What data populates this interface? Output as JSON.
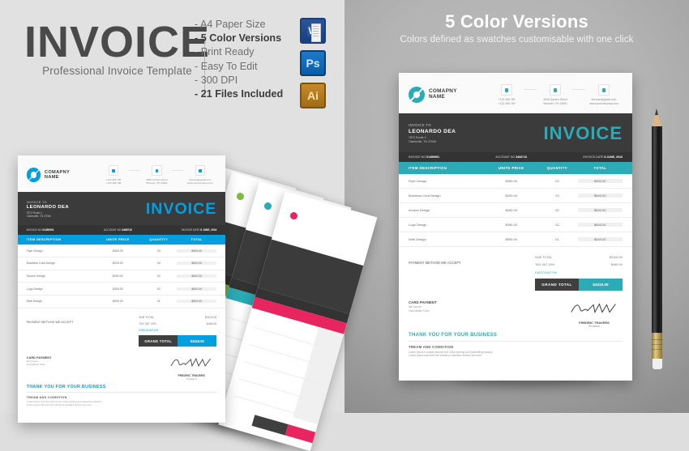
{
  "header": {
    "title": "INVOICE",
    "subtitle": "Professional Invoice Template",
    "features": [
      {
        "text": "- A4 Paper Size",
        "bold": false
      },
      {
        "text": "- 5 Color Versions",
        "bold": true
      },
      {
        "text": "- Print Ready",
        "bold": false
      },
      {
        "text": "- Easy To Edit",
        "bold": false
      },
      {
        "text": "- 300 DPI",
        "bold": false
      },
      {
        "text": "- 21 Files Included",
        "bold": true
      }
    ],
    "badges": [
      {
        "name": "microsoft-word",
        "label": "W"
      },
      {
        "name": "adobe-photoshop",
        "label": "Ps"
      },
      {
        "name": "adobe-illustrator",
        "label": "Ai"
      }
    ]
  },
  "right_panel": {
    "title": "5 Color Versions",
    "subtitle": "Colors defined as swatches customisable with one click"
  },
  "invoice": {
    "company_name_line1": "COMAPNY",
    "company_name_line2": "NAME",
    "contacts": [
      {
        "icon": "phone-icon",
        "line1": "+123 456 789",
        "line2": "+123 456 789"
      },
      {
        "icon": "location-icon",
        "line1": "4938 Garden Street",
        "line2": "Wooster, OH 44691"
      },
      {
        "icon": "email-icon",
        "line1": "liceman@gmail.com",
        "line2": "www.yourcompany.com"
      }
    ],
    "bill_to_label": "INVOICE TO",
    "bill_to_name": "LEONARDO DEA",
    "bill_to_addr1": "7872 Route 4",
    "bill_to_addr2": "Clarksville, TN 37040",
    "title_word": "INVOICE",
    "meta": [
      {
        "label": "INVOICE NO",
        "value": "01459991"
      },
      {
        "label": "ACCOUNT NO",
        "value": "3468716"
      },
      {
        "label": "INVOICE DATE",
        "value": "8 JUNE, 2016"
      }
    ],
    "table": {
      "columns": [
        "ITEM DESCRIPTION",
        "UNITE PRICE",
        "QUANTITY",
        "TOTAL"
      ],
      "rows": [
        {
          "item": "Flyer Design",
          "price": "$300.00",
          "qty": "03",
          "total": "$900.00"
        },
        {
          "item": "Business Card Design",
          "price": "$200.00",
          "qty": "03",
          "total": "$600.00"
        },
        {
          "item": "Invoice Design",
          "price": "$250.00",
          "qty": "02",
          "total": "$500.00"
        },
        {
          "item": "Logo Design",
          "price": "$300.00",
          "qty": "02",
          "total": "$600.00"
        },
        {
          "item": "Web Design",
          "price": "$500.00",
          "qty": "01",
          "total": "$500.00"
        }
      ]
    },
    "summary": [
      {
        "label": "SUB TOTAL",
        "value": "$3100.00"
      },
      {
        "label": "TAX VAT 15%",
        "value": "$465.00"
      },
      {
        "label": "DISCOUNT 0%",
        "value": ""
      }
    ],
    "grand_total_label": "GRAND TOTAL",
    "grand_total_value": "$3410.00",
    "payment_method_label": "PAYMENT METHOD WE ACCEPT",
    "card_payment_title": "CARD PAYMENT",
    "card_payment_line1": "We Accept",
    "card_payment_line2": "Visa Master Card",
    "thanks": "THANK YOU FOR YOUR BUSINESS",
    "terms_title": "TREAM AND CONDITION",
    "terms_line1": "Lorem Ipsum is simply dummy text of the printing and typesetting industry",
    "terms_line2": "Lorem Ipsum has been the industry's standard dummy text ever.",
    "signature_name": "FREDRIC TRAVERS",
    "signature_role": "President"
  },
  "color_versions": [
    {
      "name": "blue",
      "accent": "#00A0E0"
    },
    {
      "name": "orange",
      "accent": "#F07D18"
    },
    {
      "name": "green",
      "accent": "#7FBB42"
    },
    {
      "name": "teal",
      "accent": "#2BABB5"
    },
    {
      "name": "pink",
      "accent": "#E8255F"
    }
  ],
  "accents": {
    "front_blue": "#00A0E0",
    "hero_teal": "#2BABB5",
    "dark": "#3B3B3B"
  }
}
